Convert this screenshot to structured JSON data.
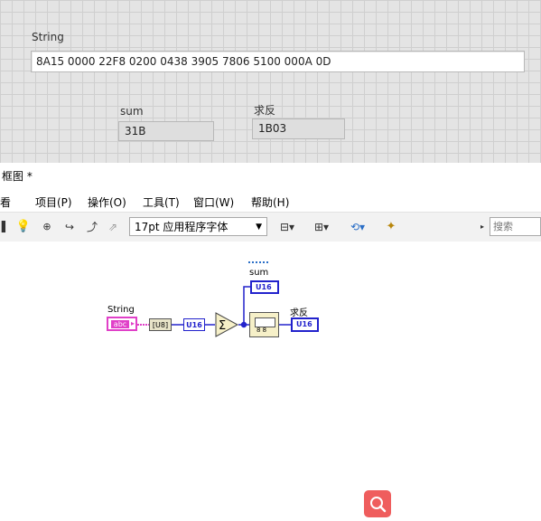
{
  "front_panel": {
    "string_control": {
      "label": "String",
      "value": "8A15 0000 22F8 0200 0438 3905 7806 5100 000A 0D"
    },
    "sum_indicator": {
      "label": "sum",
      "value": "31B"
    },
    "negate_indicator": {
      "label": "求反",
      "value": "1B03"
    }
  },
  "window": {
    "title": "框图 *"
  },
  "menu": {
    "items": [
      "看",
      "项目(P)",
      "操作(O)",
      "工具(T)",
      "窗口(W)",
      "帮助(H)"
    ]
  },
  "toolbar": {
    "font_select": "17pt 应用程序字体",
    "search_placeholder": "搜索",
    "icons": [
      "pause-icon",
      "highlight-execution-icon",
      "retain-wire-values-icon",
      "step-into-icon",
      "step-over-icon",
      "step-out-icon",
      "align-objects-icon",
      "distribute-objects-icon",
      "reorder-icon",
      "clean-up-icon"
    ]
  },
  "block_diagram": {
    "string_terminal": {
      "label": "String",
      "glyph": "abc"
    },
    "to_u8_node": "[U8]",
    "convert_node": "U16",
    "sum_terminal": {
      "label": "sum",
      "type": "U16"
    },
    "negate_terminal": {
      "label": "求反",
      "type": "U16"
    },
    "add_array_symbol": "Σ",
    "not_node_text": "8  8",
    "colors": {
      "string_wire": "#e040c8",
      "numeric_wire": "#2222cc",
      "search_button": "#ef5d5d"
    }
  }
}
